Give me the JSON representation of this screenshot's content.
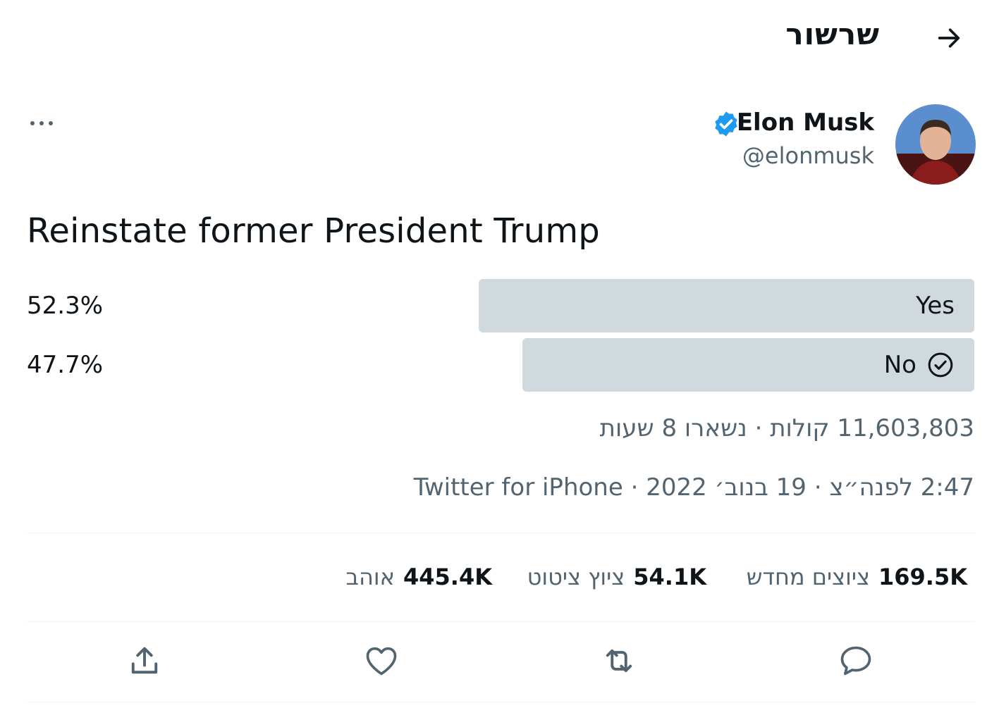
{
  "header": {
    "title": "שרשור",
    "back_icon": "arrow-right-icon"
  },
  "author": {
    "name": "Elon Musk",
    "handle": "@elonmusk",
    "verified": true,
    "verified_color": "#1d9bf0"
  },
  "more_icon": "more-horizontal-icon",
  "tweet": {
    "text": "Reinstate former President Trump"
  },
  "poll": {
    "options": [
      {
        "label": "Yes",
        "percent_text": "52.3%",
        "percent": 52.3,
        "selected": false
      },
      {
        "label": "No",
        "percent_text": "47.7%",
        "percent": 47.7,
        "selected": true
      }
    ],
    "summary": "11,603,803 קולות · נשארו 8 שעות"
  },
  "timestamp": "2:47 לפנה״צ · 19 בנוב׳ 2022 · Twitter for iPhone",
  "stats": {
    "retweets": {
      "value": "169.5K",
      "label": "ציוצים מחדש"
    },
    "quotes": {
      "value": "54.1K",
      "label": "ציוץ ציטוט"
    },
    "likes": {
      "value": "445.4K",
      "label": "אוהב"
    }
  },
  "actions": [
    "reply-icon",
    "retweet-icon",
    "like-icon",
    "share-icon"
  ],
  "colors": {
    "secondary_text": "#536471",
    "poll_bar": "#cfd9de",
    "divider": "#eff3f4"
  }
}
